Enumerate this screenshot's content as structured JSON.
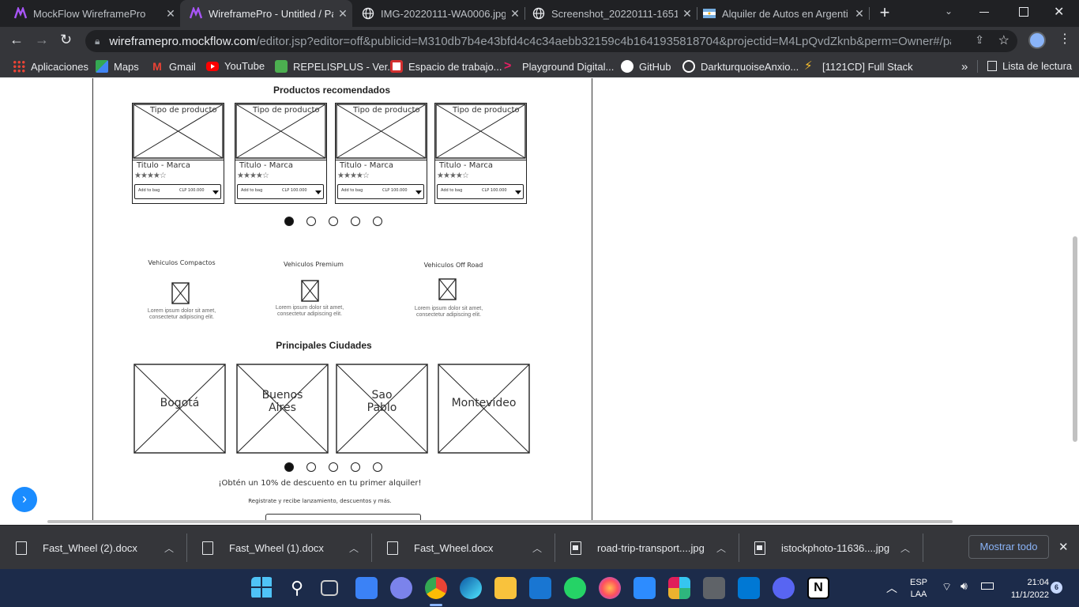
{
  "tabs": [
    {
      "label": "MockFlow WireframePro",
      "active": false
    },
    {
      "label": "WireframePro - Untitled / Pa",
      "active": true
    },
    {
      "label": "IMG-20220111-WA0006.jpg (",
      "active": false
    },
    {
      "label": "Screenshot_20220111-16510",
      "active": false
    },
    {
      "label": "Alquiler de Autos en Argenti",
      "active": false
    }
  ],
  "new_tab_label": "+",
  "address": {
    "host": "wireframepro.mockflow.com",
    "path": "/editor.jsp?editor=off&publicid=M310db7b4e43bfd4c4c34aebb32159c4b1641935818704&projectid=M4LpQvdZknb&perm=Owner#/page/de7..."
  },
  "bookmarks": [
    {
      "label": "Aplicaciones",
      "icon": "apps-grid-icon",
      "color": "#ea4335"
    },
    {
      "label": "Maps",
      "icon": "maps-icon",
      "color": "#34a853"
    },
    {
      "label": "Gmail",
      "icon": "gmail-icon",
      "color": "#ea4335"
    },
    {
      "label": "YouTube",
      "icon": "youtube-icon",
      "color": "#ff0000"
    },
    {
      "label": "REPELISPLUS - Ver...",
      "icon": "repelis-icon",
      "color": "#4caf50"
    },
    {
      "label": "Espacio de trabajo...",
      "icon": "trello-icon",
      "color": "#d32f2f"
    },
    {
      "label": "Playground Digital...",
      "icon": "playground-icon",
      "color": "#e91e63"
    },
    {
      "label": "GitHub",
      "icon": "github-icon",
      "color": "#ffffff"
    },
    {
      "label": "DarkturquoiseAnxio...",
      "icon": "replit-icon",
      "color": "#ffffff"
    },
    {
      "label": "[1121CD] Full Stack",
      "icon": "bolt-icon",
      "color": "#fbc02d"
    }
  ],
  "reading_list": "Lista de lectura",
  "wireframe": {
    "products_title": "Productos recomendados",
    "products": [
      {
        "type": "Tipo de producto",
        "title": "Titulo - Marca",
        "add": "Add to bag",
        "price": "CLP 100.000"
      },
      {
        "type": "Tipo de producto",
        "title": "Titulo - Marca",
        "add": "Add to bag",
        "price": "CLP 100.000"
      },
      {
        "type": "Tipo de producto",
        "title": "Titulo - Marca",
        "add": "Add to bag",
        "price": "CLP 100.000"
      },
      {
        "type": "Tipo de producto",
        "title": "Titulo - Marca",
        "add": "Add to bag",
        "price": "CLP 100.000"
      }
    ],
    "stars_filled": 4,
    "stars_total": 5,
    "categories": [
      {
        "title": "Vehiculos Compactos",
        "text1": "Lorem ipsum dolor sit amet,",
        "text2": "consectetur adipiscing elit."
      },
      {
        "title": "Vehiculos Premium",
        "text1": "Lorem ipsum dolor sit amet,",
        "text2": "consectetur adipiscing elit."
      },
      {
        "title": "Vehiculos Off Road",
        "text1": "Lorem ipsum dolor sit amet,",
        "text2": "consectetur adipiscing elit."
      }
    ],
    "cities_title": "Principales Ciudades",
    "cities": [
      {
        "line1": "Bogotá",
        "line2": ""
      },
      {
        "line1": "Buenos",
        "line2": "Aires"
      },
      {
        "line1": "Sao",
        "line2": "Pablo"
      },
      {
        "line1": "Montevideo",
        "line2": ""
      }
    ],
    "promo": "¡Obtén un 10% de descuento en tu primer alquiler!",
    "promo_sub": "Registrate y recibe lanzamiento, descuentos y más."
  },
  "downloads": [
    {
      "name": "Fast_Wheel (2).docx",
      "kind": "doc"
    },
    {
      "name": "Fast_Wheel (1).docx",
      "kind": "doc"
    },
    {
      "name": "Fast_Wheel.docx",
      "kind": "doc"
    },
    {
      "name": "road-trip-transport....jpg",
      "kind": "img"
    },
    {
      "name": "istockphoto-11636....jpg",
      "kind": "img"
    }
  ],
  "show_all": "Mostrar todo",
  "taskbar": {
    "lang1": "ESP",
    "lang2": "LAA",
    "time": "21:04",
    "date": "11/1/2022",
    "notif_count": "6"
  }
}
